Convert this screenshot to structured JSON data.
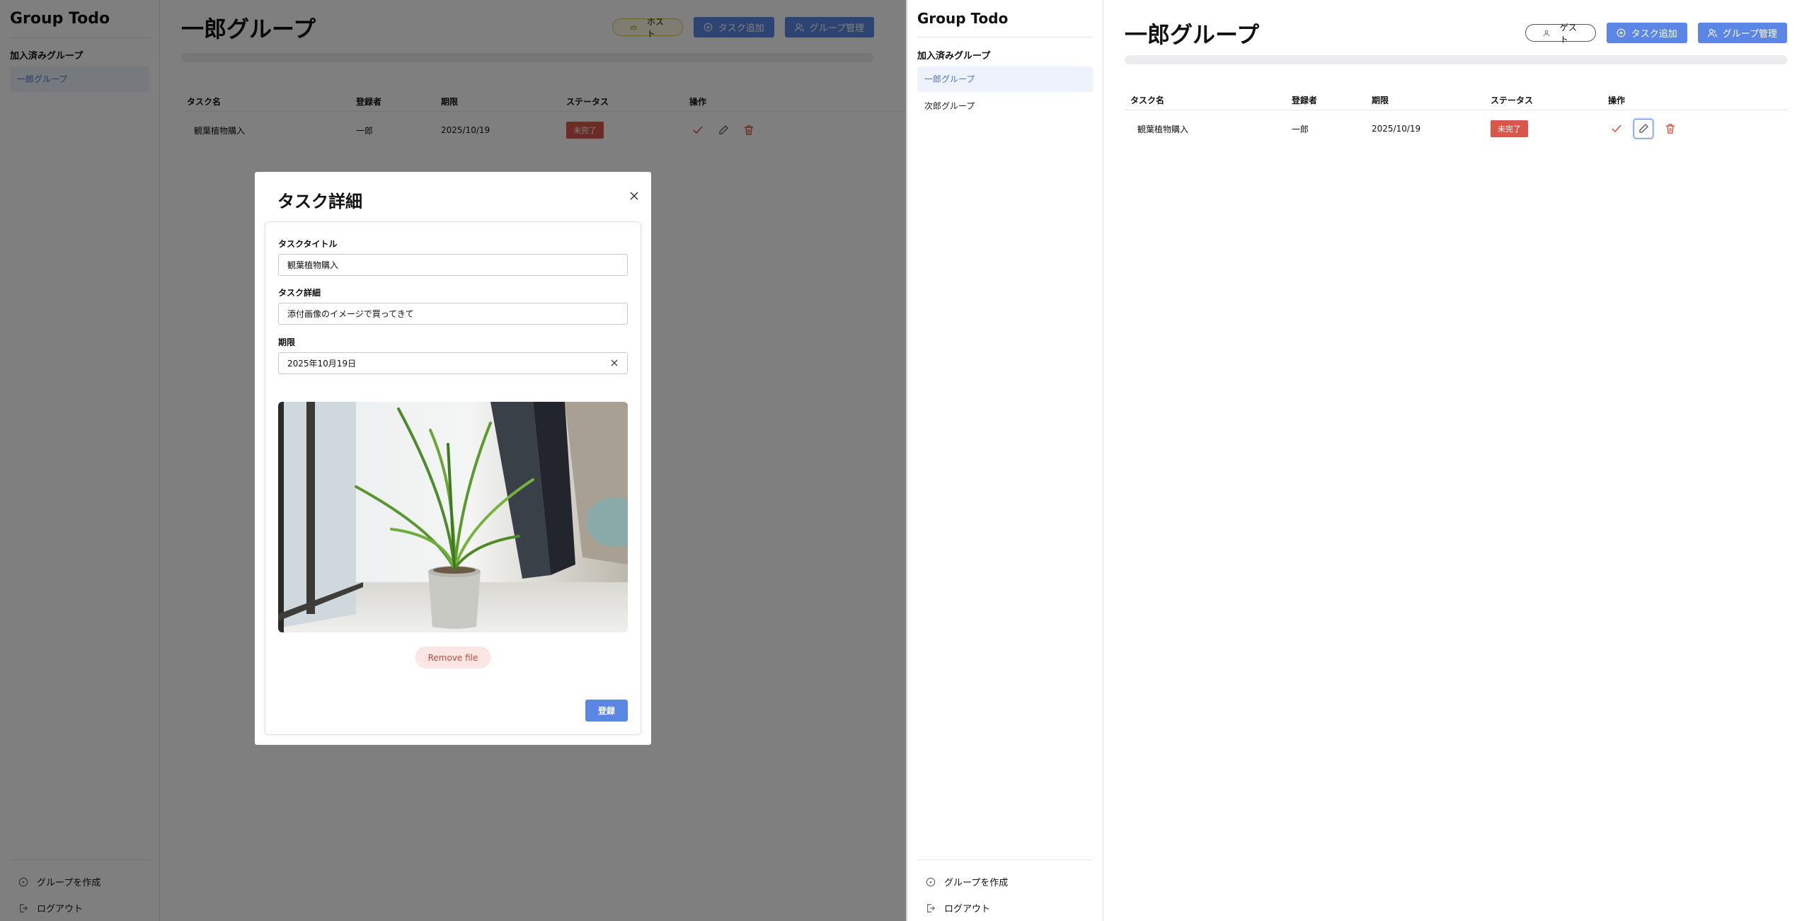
{
  "app": {
    "name": "Group Todo"
  },
  "sidebar": {
    "section_label": "加入済みグループ",
    "left_groups": [
      {
        "label": "一郎グループ"
      }
    ],
    "right_groups": [
      {
        "label": "一郎グループ"
      },
      {
        "label": "次郎グループ"
      }
    ],
    "create_group": "グループを作成",
    "logout": "ログアウト"
  },
  "group": {
    "title": "一郎グループ",
    "left_role": "ホスト",
    "right_role": "ゲスト",
    "add_task": "タスク追加",
    "manage_group": "グループ管理"
  },
  "table": {
    "headers": [
      "タスク名",
      "登録者",
      "期限",
      "ステータス",
      "操作"
    ],
    "rows": [
      {
        "title": "観葉植物購入",
        "user": "一郎",
        "due": "2025/10/19",
        "status": "未完了"
      }
    ]
  },
  "modal": {
    "title": "タスク詳細",
    "title_label": "タスクタイトル",
    "title_value": "観葉植物購入",
    "detail_label": "タスク詳細",
    "detail_value": "添付画像のイメージで買ってきて",
    "due_label": "期限",
    "due_value": "2025年10月19日",
    "remove_file": "Remove file",
    "submit": "登録"
  },
  "colors": {
    "primary": "#5b86e5",
    "danger": "#d9574a",
    "active_bg": "#edf2fc",
    "host_pill": "#e8c842"
  },
  "icons": [
    "user-icon",
    "crown-icon",
    "plus-circle-icon",
    "users-icon",
    "check-icon",
    "pencil-icon",
    "trash-icon",
    "close-icon",
    "logout-icon"
  ]
}
